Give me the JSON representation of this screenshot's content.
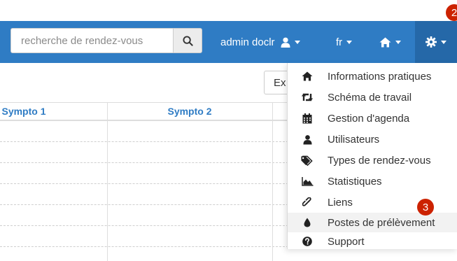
{
  "search": {
    "placeholder": "recherche de rendez-vous"
  },
  "navbar": {
    "user_label": "admin doclr",
    "lang_label": "fr"
  },
  "annotations": {
    "badge_2": "2",
    "badge_3": "3"
  },
  "toolbar": {
    "export_label": "Ex"
  },
  "table": {
    "columns": [
      "Sympto 1",
      "Sympto 2"
    ],
    "row_count": 6
  },
  "menu": {
    "items": [
      {
        "label": "Informations pratiques",
        "icon": "home-icon"
      },
      {
        "label": "Schéma de travail",
        "icon": "retweet-icon"
      },
      {
        "label": "Gestion d'agenda",
        "icon": "calendar-icon"
      },
      {
        "label": "Utilisateurs",
        "icon": "user-icon"
      },
      {
        "label": "Types de rendez-vous",
        "icon": "tags-icon"
      },
      {
        "label": "Statistiques",
        "icon": "area-chart-icon"
      },
      {
        "label": "Liens",
        "icon": "link-icon"
      },
      {
        "label": "Postes de prélèvement",
        "icon": "drop-icon"
      },
      {
        "label": "Support",
        "icon": "question-circle-icon"
      }
    ]
  },
  "colors": {
    "navbar": "#2f7cc4",
    "navbar_active": "#2568a8",
    "badge": "#cc2200",
    "header_text": "#2f7cc4"
  }
}
